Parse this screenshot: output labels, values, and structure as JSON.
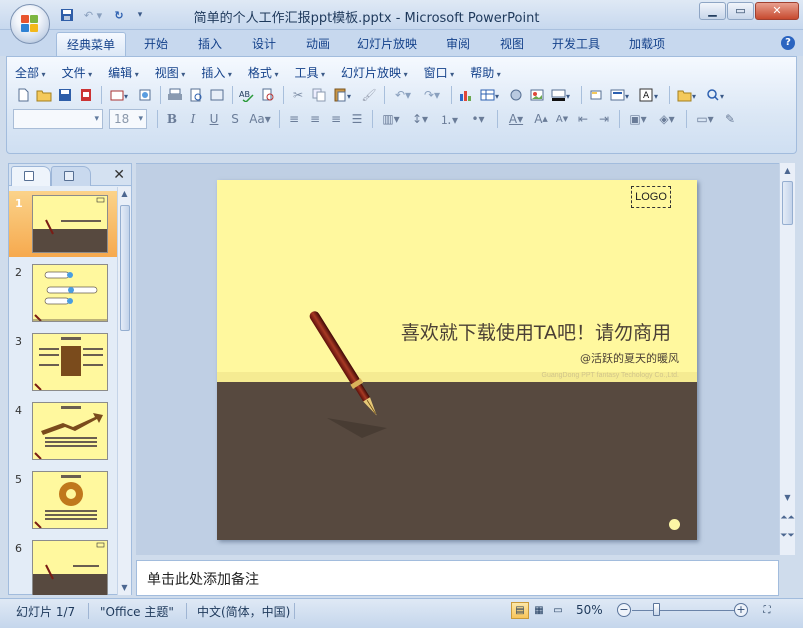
{
  "window": {
    "title": "简单的个人工作汇报ppt模板.pptx - Microsoft PowerPoint"
  },
  "tabs": [
    "经典菜单",
    "开始",
    "插入",
    "设计",
    "动画",
    "幻灯片放映",
    "审阅",
    "视图",
    "开发工具",
    "加载项"
  ],
  "active_tab": "经典菜单",
  "menu": [
    "全部",
    "文件",
    "编辑",
    "视图",
    "插入",
    "格式",
    "工具",
    "幻灯片放映",
    "窗口",
    "帮助"
  ],
  "format": {
    "font_size": "18"
  },
  "thumbnails": [
    {
      "num": "1"
    },
    {
      "num": "2"
    },
    {
      "num": "3"
    },
    {
      "num": "4"
    },
    {
      "num": "5"
    },
    {
      "num": "6"
    }
  ],
  "slide": {
    "logo": "LOGO",
    "title": "喜欢就下载使用TA吧！请勿商用",
    "subtitle": "@活跃的夏天的暖风",
    "company": "GuangDong PPT fantasy Techology Co.,Ltd.",
    "colors": {
      "top": "#fff89e",
      "bottom": "#57493f"
    }
  },
  "notes": {
    "placeholder": "单击此处添加备注"
  },
  "status": {
    "slide_count": "幻灯片 1/7",
    "theme": "\"Office 主题\"",
    "language": "中文(简体，中国)",
    "zoom": "50%"
  }
}
